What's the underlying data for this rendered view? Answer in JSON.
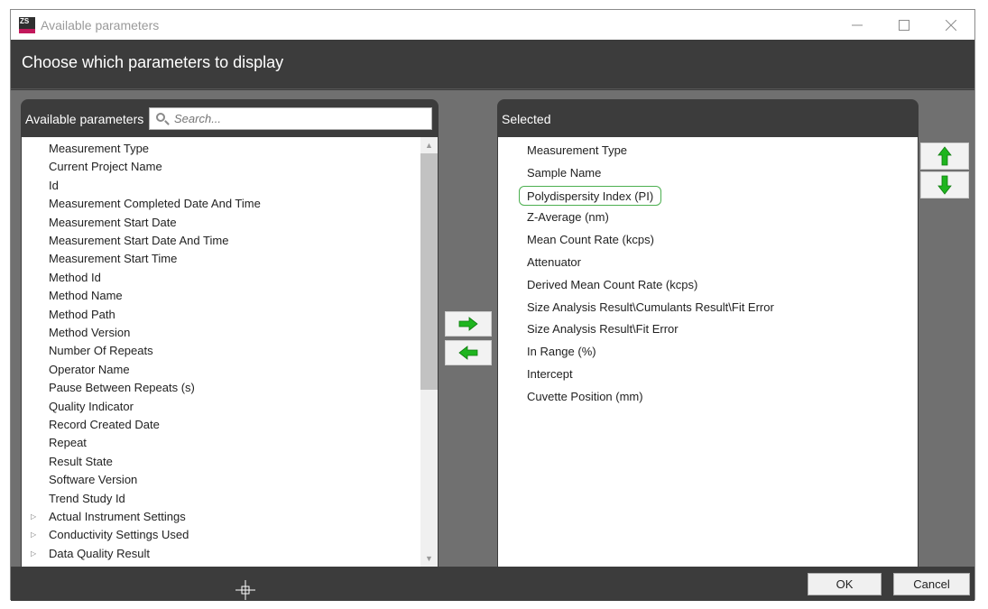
{
  "window": {
    "title": "Available parameters",
    "app_icon_text": "ZS"
  },
  "header": {
    "title": "Choose which parameters to display"
  },
  "available": {
    "label": "Available parameters",
    "search_placeholder": "Search...",
    "items": [
      {
        "label": "Measurement Type",
        "expandable": false
      },
      {
        "label": "Current Project Name",
        "expandable": false
      },
      {
        "label": "Id",
        "expandable": false
      },
      {
        "label": "Measurement Completed Date And Time",
        "expandable": false
      },
      {
        "label": "Measurement Start Date",
        "expandable": false
      },
      {
        "label": "Measurement Start Date And Time",
        "expandable": false
      },
      {
        "label": "Measurement Start Time",
        "expandable": false
      },
      {
        "label": "Method Id",
        "expandable": false
      },
      {
        "label": "Method Name",
        "expandable": false
      },
      {
        "label": "Method Path",
        "expandable": false
      },
      {
        "label": "Method Version",
        "expandable": false
      },
      {
        "label": "Number Of Repeats",
        "expandable": false
      },
      {
        "label": "Operator Name",
        "expandable": false
      },
      {
        "label": "Pause Between Repeats (s)",
        "expandable": false
      },
      {
        "label": "Quality Indicator",
        "expandable": false
      },
      {
        "label": "Record Created Date",
        "expandable": false
      },
      {
        "label": "Repeat",
        "expandable": false
      },
      {
        "label": "Result State",
        "expandable": false
      },
      {
        "label": "Software Version",
        "expandable": false
      },
      {
        "label": "Trend Study Id",
        "expandable": false
      },
      {
        "label": "Actual Instrument Settings",
        "expandable": true
      },
      {
        "label": "Conductivity Settings Used",
        "expandable": true
      },
      {
        "label": "Data Quality Result",
        "expandable": true
      }
    ]
  },
  "selected": {
    "label": "Selected",
    "highlighted_index": 2,
    "items": [
      "Measurement Type",
      "Sample Name",
      "Polydispersity Index (PI)",
      "Z-Average (nm)",
      "Mean Count Rate (kcps)",
      "Attenuator",
      "Derived Mean Count Rate (kcps)",
      "Size Analysis Result\\Cumulants Result\\Fit Error",
      "Size Analysis Result\\Fit Error",
      "In Range (%)",
      "Intercept",
      "Cuvette Position (mm)"
    ]
  },
  "icons": {
    "add": "arrow-right-icon",
    "remove": "arrow-left-icon",
    "move_up": "arrow-up-icon",
    "move_down": "arrow-down-icon",
    "color": "#1fb51f"
  },
  "footer": {
    "ok_label": "OK",
    "cancel_label": "Cancel"
  }
}
